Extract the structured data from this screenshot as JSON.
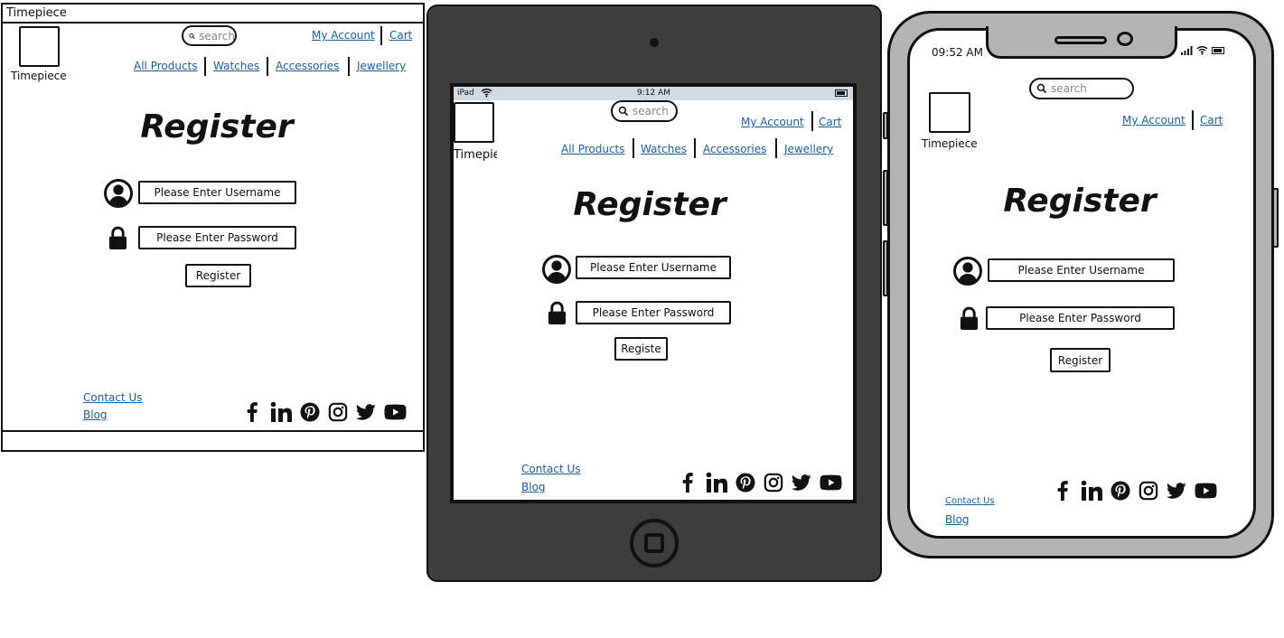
{
  "desktop": {
    "window_title": "Timepiece",
    "logo_label": "Timepiece",
    "search_placeholder": "search",
    "top_links": {
      "account": "My Account",
      "cart": "Cart"
    },
    "nav": [
      "All Products",
      "Watches",
      "Accessories",
      "Jewellery"
    ],
    "heading": "Register",
    "username_placeholder": "Please Enter Username",
    "password_placeholder": "Please Enter Password",
    "register_button": "Register",
    "footer_links": [
      "Contact Us",
      "Blog"
    ]
  },
  "tablet": {
    "status": {
      "device": "iPad",
      "time": "9:12 AM"
    },
    "logo_label": "Timepie",
    "search_placeholder": "search",
    "top_links": {
      "account": "My Account",
      "cart": "Cart"
    },
    "nav": [
      "All Products",
      "Watches",
      "Accessories",
      "Jewellery"
    ],
    "heading": "Register",
    "username_placeholder": "Please Enter Username",
    "password_placeholder": "Please Enter Password",
    "register_button": "Registe",
    "footer_links": [
      "Contact Us",
      "Blog"
    ]
  },
  "phone": {
    "status": {
      "time": "09:52 AM"
    },
    "logo_label": "Timepiece",
    "search_placeholder": "search",
    "top_links": {
      "account": "My Account",
      "cart": "Cart"
    },
    "heading": "Register",
    "username_placeholder": "Please Enter Username",
    "password_placeholder": "Please Enter Password",
    "register_button": "Register",
    "footer_links": [
      "Contact Us",
      "Blog"
    ]
  },
  "social_icons": [
    "facebook-icon",
    "linkedin-icon",
    "pinterest-icon",
    "instagram-icon",
    "twitter-icon",
    "youtube-icon"
  ],
  "colors": {
    "link": "#1a5fa0",
    "tablet_frame": "#3d3d3d",
    "phone_frame": "#b4b4b4",
    "tablet_status_bar": "#d4dbe0"
  }
}
